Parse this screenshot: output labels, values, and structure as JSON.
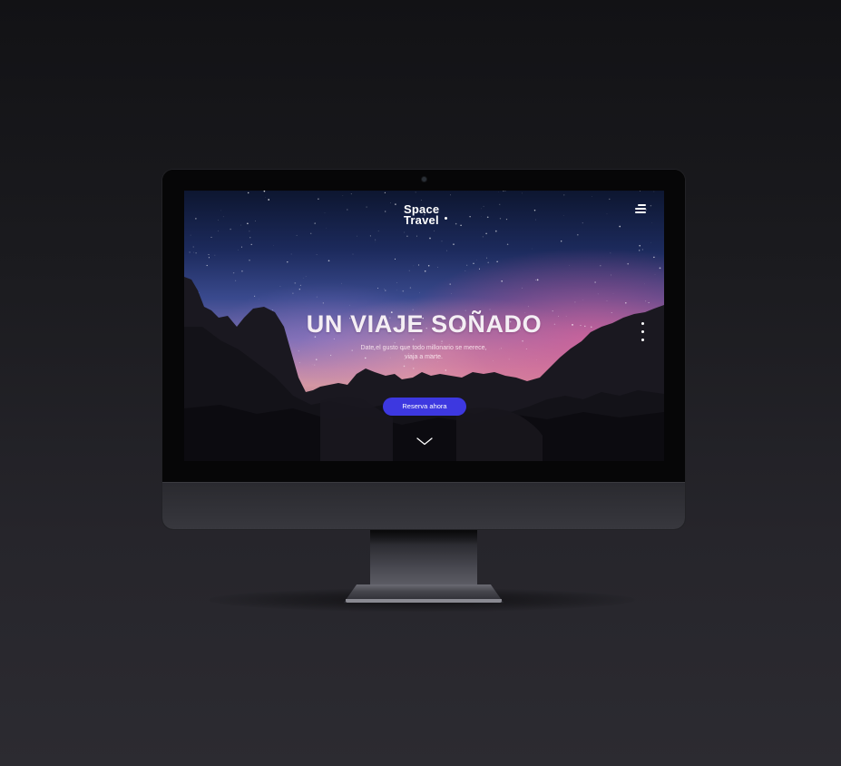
{
  "page": {
    "background": "#1b1b1f"
  },
  "device": {
    "type": "iMac mockup",
    "bezel_color": "#060607",
    "chin_color": "#323238"
  },
  "site": {
    "brand_line1": "Space",
    "brand_line2": "Travel",
    "menu_icon": "hamburger-menu-icon",
    "side_dots_icon": "vertical-dots-icon",
    "hero": {
      "headline": "UN VIAJE SOÑADO",
      "subtitle_line1": "Date el gusto que todo millonario se merece,",
      "subtitle_line2": "viaja a marte.",
      "cta_label": "Reserva ahora",
      "cta_color": "#3d38e0",
      "scroll_icon": "chevron-down-icon"
    }
  }
}
